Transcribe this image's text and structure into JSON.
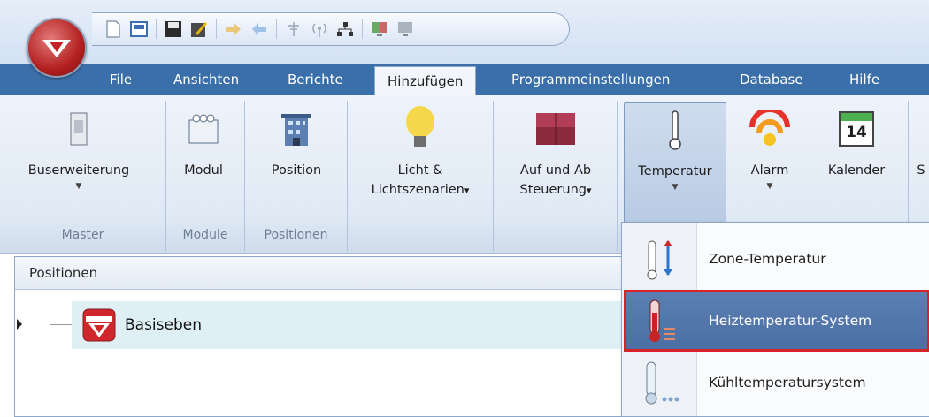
{
  "quick_access": {
    "icons": [
      "new-icon",
      "open-icon",
      "save-icon",
      "edit-icon",
      "import-icon",
      "export-icon",
      "antenna-icon",
      "wireless-icon",
      "network-icon",
      "monitor-color-icon",
      "monitor-icon"
    ]
  },
  "tabs": [
    {
      "label": "File"
    },
    {
      "label": "Ansichten"
    },
    {
      "label": "Berichte"
    },
    {
      "label": "Hinzufügen",
      "active": true
    },
    {
      "label": "Programmeinstellungen"
    },
    {
      "label": "Database"
    },
    {
      "label": "Hilfe"
    }
  ],
  "ribbon": {
    "buttons": {
      "buserweiterung": {
        "label": "Buserweiterung",
        "dropdown": "▼"
      },
      "modul": {
        "label": "Modul"
      },
      "position": {
        "label": "Position"
      },
      "licht": {
        "line1": "Licht &",
        "line2": "Lichtszenarien",
        "dropdown": "▾"
      },
      "aufab": {
        "line1": "Auf und Ab",
        "line2": "Steuerung",
        "dropdown": "▾"
      },
      "temperatur": {
        "label": "Temperatur",
        "dropdown": "▼"
      },
      "alarm": {
        "label": "Alarm",
        "dropdown": "▼"
      },
      "kalender": {
        "label": "Kalender",
        "day": "14"
      },
      "cut": {
        "label": "S"
      }
    },
    "groups": {
      "master": "Master",
      "module": "Module",
      "positionen": "Positionen"
    }
  },
  "panel": {
    "title": "Positionen",
    "tree_item": "Basiseben"
  },
  "menu": {
    "items": [
      {
        "label": "Zone-Temperatur",
        "icon": "zone-thermometer-icon"
      },
      {
        "label": "Heiztemperatur-System",
        "icon": "heating-thermometer-icon",
        "highlighted": true
      },
      {
        "label": "Kühltemperatursystem",
        "icon": "cooling-thermometer-icon"
      }
    ]
  },
  "colors": {
    "tab_bar": "#3b6fa9",
    "highlight": "#4f73a8",
    "highlight_border": "#d7222a",
    "brand_red": "#c41f24"
  }
}
